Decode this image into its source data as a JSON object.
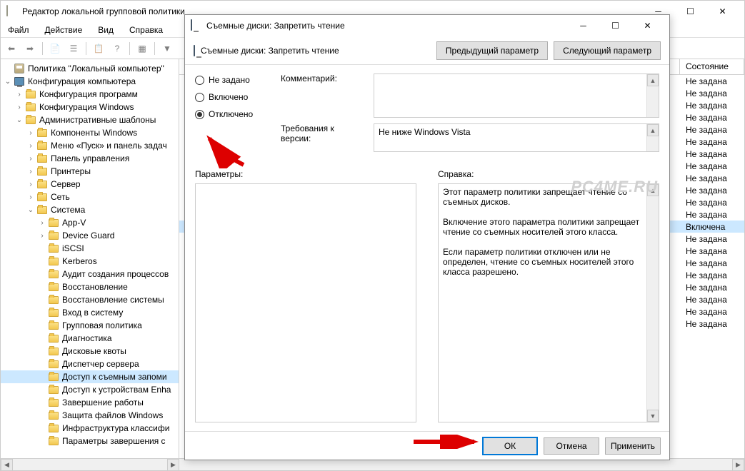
{
  "main_window": {
    "title": "Редактор локальной групповой политики",
    "menu": [
      "Файл",
      "Действие",
      "Вид",
      "Справка"
    ]
  },
  "tree": {
    "root": "Политика \"Локальный компьютер\"",
    "comp_config": "Конфигурация компьютера",
    "items": [
      "Конфигурация программ",
      "Конфигурация Windows",
      "Административные шаблоны"
    ],
    "admin_children": [
      "Компоненты Windows",
      "Меню «Пуск» и панель задач",
      "Панель управления",
      "Принтеры",
      "Сервер",
      "Сеть",
      "Система"
    ],
    "system_children": [
      "App-V",
      "Device Guard",
      "iSCSI",
      "Kerberos",
      "Аудит создания процессов",
      "Восстановление",
      "Восстановление системы",
      "Вход в систему",
      "Групповая политика",
      "Диагностика",
      "Дисковые квоты",
      "Диспетчер сервера",
      "Доступ к съемным запоми",
      "Доступ к устройствам Enha",
      "Завершение работы",
      "Защита файлов Windows",
      "Инфраструктура классифи",
      "Параметры завершения с"
    ],
    "selected_index": 12
  },
  "right_panel": {
    "header_state": "Состояние",
    "states": [
      "Не задана",
      "Не задана",
      "Не задана",
      "Не задана",
      "Не задана",
      "Не задана",
      "Не задана",
      "Не задана",
      "Не задана",
      "Не задана",
      "Не задана",
      "Не задана",
      "Включена",
      "Не задана",
      "Не задана",
      "Не задана",
      "Не задана",
      "Не задана",
      "Не задана",
      "Не задана",
      "Не задана"
    ],
    "selected_index": 12
  },
  "dialog": {
    "title": "Съемные диски: Запретить чтение",
    "header_label": "Съемные диски: Запретить чтение",
    "prev_btn": "Предыдущий параметр",
    "next_btn": "Следующий параметр",
    "radio_not_set": "Не задано",
    "radio_enabled": "Включено",
    "radio_disabled": "Отключено",
    "radio_selected": "disabled",
    "comment_label": "Комментарий:",
    "requirements_label": "Требования к версии:",
    "requirements_value": "Не ниже Windows Vista",
    "params_label": "Параметры:",
    "help_label": "Справка:",
    "help_text": "Этот параметр политики запрещает чтение со съемных дисков.\n\nВключение этого параметра политики запрещает чтение со съемных носителей этого класса.\n\nЕсли параметр политики отключен или не определен, чтение со съемных носителей этого класса разрешено.",
    "ok": "ОК",
    "cancel": "Отмена",
    "apply": "Применить"
  },
  "watermark": "PC4ME.RU"
}
